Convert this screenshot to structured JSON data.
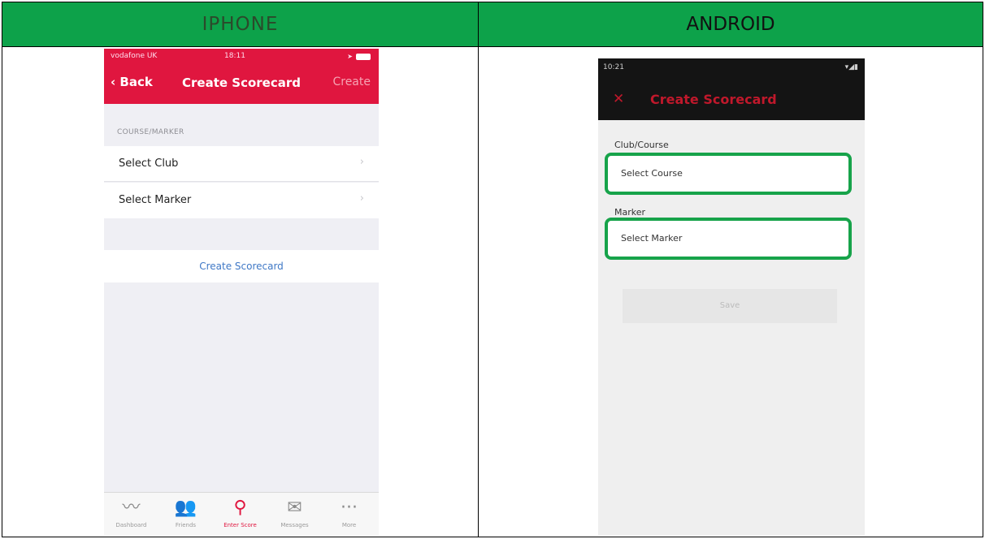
{
  "columns": {
    "iphone_title": "IPHONE",
    "android_title": "ANDROID"
  },
  "iphone": {
    "status": {
      "carrier": "vodafone UK",
      "time": "18:11"
    },
    "nav": {
      "back": "Back",
      "title": "Create Scorecard",
      "action": "Create"
    },
    "section_label": "COURSE/MARKER",
    "rows": [
      {
        "label": "Select Club",
        "chevron": "›"
      },
      {
        "label": "Select Marker",
        "chevron": "›"
      }
    ],
    "create_button": "Create Scorecard",
    "tabs": [
      {
        "icon": "dashboard-icon",
        "glyph": "〰",
        "label": "Dashboard"
      },
      {
        "icon": "friends-icon",
        "glyph": "👥",
        "label": "Friends"
      },
      {
        "icon": "enter-score-icon",
        "glyph": "⚲",
        "label": "Enter Score"
      },
      {
        "icon": "messages-icon",
        "glyph": "✉",
        "label": "Messages"
      },
      {
        "icon": "more-icon",
        "glyph": "···",
        "label": "More"
      }
    ],
    "accent": "#e0163f"
  },
  "android": {
    "status": {
      "time": "10:21"
    },
    "close": "✕",
    "title": "Create Scorecard",
    "club_label": "Club/Course",
    "club_value": "Select Course",
    "marker_label": "Marker",
    "marker_value": "Select Marker",
    "save": "Save",
    "accent": "#c0182b",
    "highlight": "#17a34a"
  },
  "header_color": "#0da24a"
}
